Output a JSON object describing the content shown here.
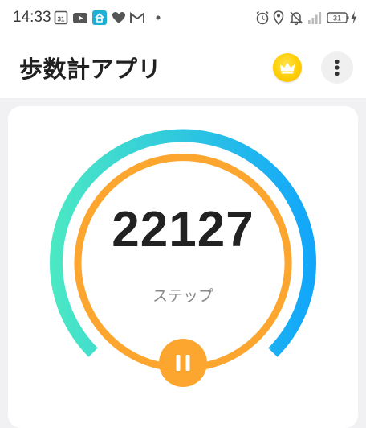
{
  "status_bar": {
    "time": "14:33",
    "calendar_badge": "31",
    "battery": "31",
    "icons": [
      "calendar-icon",
      "youtube-icon",
      "home-app-icon",
      "heart-icon",
      "gmail-icon",
      "notification-dot-icon",
      "alarm-icon",
      "location-icon",
      "bell-icon",
      "signal-icon",
      "battery-icon",
      "charging-icon"
    ]
  },
  "app_bar": {
    "title": "歩数計アプリ",
    "icons": [
      "crown-icon",
      "more-vert-icon"
    ]
  },
  "pedometer": {
    "steps": "22127",
    "steps_label": "ステップ",
    "colors": {
      "outer_arc_start": "#4be8c4",
      "outer_arc_end": "#12a6fb",
      "inner_ring": "#fca630",
      "pause_button": "#fca630"
    }
  }
}
